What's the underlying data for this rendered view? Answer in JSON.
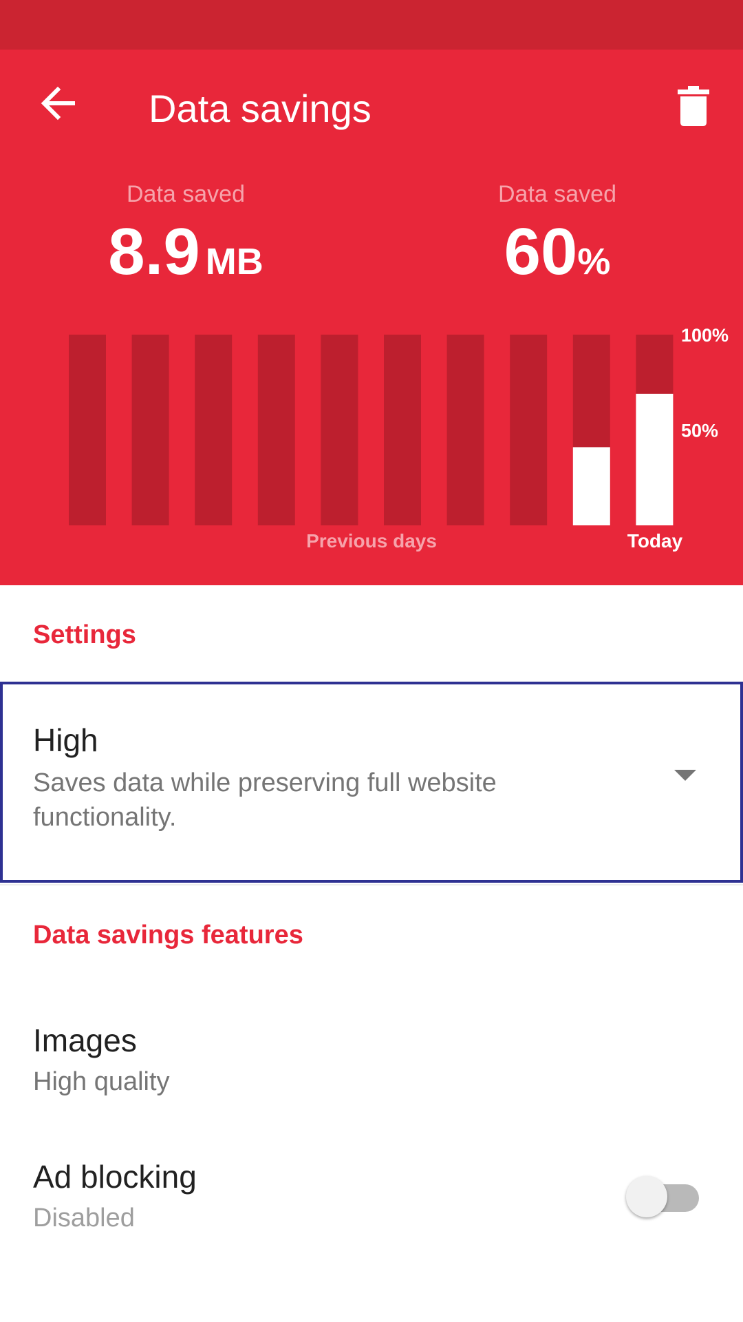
{
  "toolbar": {
    "title": "Data savings",
    "back_icon": "arrow-back-icon",
    "delete_icon": "trash-icon"
  },
  "stats": {
    "data_saved_amount": {
      "label": "Data saved",
      "value": "8.9",
      "unit": "MB"
    },
    "data_saved_percent": {
      "label": "Data saved",
      "value": "60",
      "unit": "%"
    }
  },
  "chart_data": {
    "type": "bar",
    "categories": [
      "",
      "",
      "",
      "",
      "",
      "",
      "",
      "",
      "",
      ""
    ],
    "values": [
      0,
      0,
      0,
      0,
      0,
      0,
      0,
      0,
      41,
      69
    ],
    "ylim": [
      0,
      100
    ],
    "y_tick_labels": [
      "100%",
      "50%"
    ],
    "x_group_labels": {
      "previous": "Previous days",
      "today": "Today"
    },
    "colors": {
      "track": "#bd1f2e",
      "fill": "#ffffff"
    },
    "grid": false
  },
  "settings": {
    "heading": "Settings",
    "mode": {
      "title": "High",
      "description": "Saves data while preserving full website functionality.",
      "icon": "dropdown-arrow-icon"
    }
  },
  "features": {
    "heading": "Data savings features",
    "images": {
      "title": "Images",
      "value": "High quality"
    },
    "ad_blocking": {
      "title": "Ad blocking",
      "value": "Disabled",
      "enabled": false
    }
  },
  "colors": {
    "status_bar": "#cb2431",
    "header": "#e8273a",
    "accent": "#e8273a",
    "focus_border": "#2e3192"
  }
}
